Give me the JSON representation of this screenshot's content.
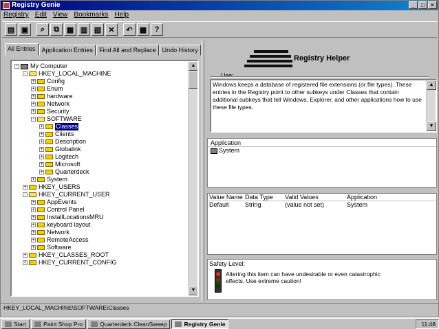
{
  "window": {
    "title": "Registry Genie"
  },
  "menu": [
    "Registry",
    "Edit",
    "View",
    "Bookmarks",
    "Help"
  ],
  "tabs": [
    "All Entries",
    "Application Entries",
    "Find All and Replace",
    "Undo History"
  ],
  "tree": [
    {
      "label": "My Computer",
      "level": 0,
      "expander": "-",
      "icon": "computer-icon"
    },
    {
      "label": "HKEY_LOCAL_MACHINE",
      "level": 1,
      "expander": "-",
      "icon": "folder-icon"
    },
    {
      "label": "Config",
      "level": 2,
      "expander": "+",
      "icon": "folder-icon"
    },
    {
      "label": "Enum",
      "level": 2,
      "expander": "+",
      "icon": "folder-icon"
    },
    {
      "label": "hardware",
      "level": 2,
      "expander": "+",
      "icon": "folder-icon"
    },
    {
      "label": "Network",
      "level": 2,
      "expander": "+",
      "icon": "folder-icon"
    },
    {
      "label": "Security",
      "level": 2,
      "expander": "+",
      "icon": "folder-icon"
    },
    {
      "label": "SOFTWARE",
      "level": 2,
      "expander": "-",
      "icon": "folder-icon"
    },
    {
      "label": "Classes",
      "level": 3,
      "expander": "+",
      "icon": "folder-icon",
      "selected": true
    },
    {
      "label": "Clients",
      "level": 3,
      "expander": "+",
      "icon": "folder-icon"
    },
    {
      "label": "Description",
      "level": 3,
      "expander": "+",
      "icon": "folder-icon"
    },
    {
      "label": "Globalink",
      "level": 3,
      "expander": "+",
      "icon": "folder-icon"
    },
    {
      "label": "Logitech",
      "level": 3,
      "expander": "+",
      "icon": "folder-icon"
    },
    {
      "label": "Microsoft",
      "level": 3,
      "expander": "+",
      "icon": "folder-icon"
    },
    {
      "label": "Quarterdeck",
      "level": 3,
      "expander": "+",
      "icon": "folder-icon"
    },
    {
      "label": "System",
      "level": 2,
      "expander": "+",
      "icon": "folder-icon"
    },
    {
      "label": "HKEY_USERS",
      "level": 1,
      "expander": "+",
      "icon": "folder-icon"
    },
    {
      "label": "HKEY_CURRENT_USER",
      "level": 1,
      "expander": "-",
      "icon": "folder-icon"
    },
    {
      "label": "AppEvents",
      "level": 2,
      "expander": "+",
      "icon": "folder-icon"
    },
    {
      "label": "Control Panel",
      "level": 2,
      "expander": "+",
      "icon": "folder-icon"
    },
    {
      "label": "InstallLocationsMRU",
      "level": 2,
      "expander": "+",
      "icon": "folder-icon"
    },
    {
      "label": "keyboard layout",
      "level": 2,
      "expander": "+",
      "icon": "folder-icon"
    },
    {
      "label": "Network",
      "level": 2,
      "expander": "+",
      "icon": "folder-icon"
    },
    {
      "label": "RemoteAccess",
      "level": 2,
      "expander": "+",
      "icon": "folder-icon"
    },
    {
      "label": "Software",
      "level": 2,
      "expander": "+",
      "icon": "folder-icon"
    },
    {
      "label": "HKEY_CLASSES_ROOT",
      "level": 1,
      "expander": "+",
      "icon": "folder-icon"
    },
    {
      "label": "HKEY_CURRENT_CONFIG",
      "level": 1,
      "expander": "+",
      "icon": "folder-icon"
    }
  ],
  "helper": {
    "title": "Registry Helper",
    "use_label": "Use:",
    "description": "Windows keeps a database of registered file extensions (or file types). These entries in the Registry point to other subkeys under Classes that contain additional subkeys that tell Windows, Explorer, and other applications how to use these file types."
  },
  "application": {
    "header": "Application",
    "value": "System"
  },
  "values": {
    "headers": [
      "Value Name",
      "Data Type",
      "Valid Values",
      "Application"
    ],
    "rows": [
      [
        "Default",
        "String",
        "(value not set)",
        "System"
      ]
    ]
  },
  "safety": {
    "label": "Safety Level:",
    "text": "Altering this item can have undesirable or even catastrophic effects. Use extreme caution!"
  },
  "status": "HKEY_LOCAL_MACHINE\\SOFTWARE\\Classes",
  "taskbar": {
    "start": "Start",
    "tasks": [
      "Paint Shop Pro",
      "Quarterdeck CleanSweep",
      "Registry Genie"
    ],
    "tray_time": "11:48"
  }
}
